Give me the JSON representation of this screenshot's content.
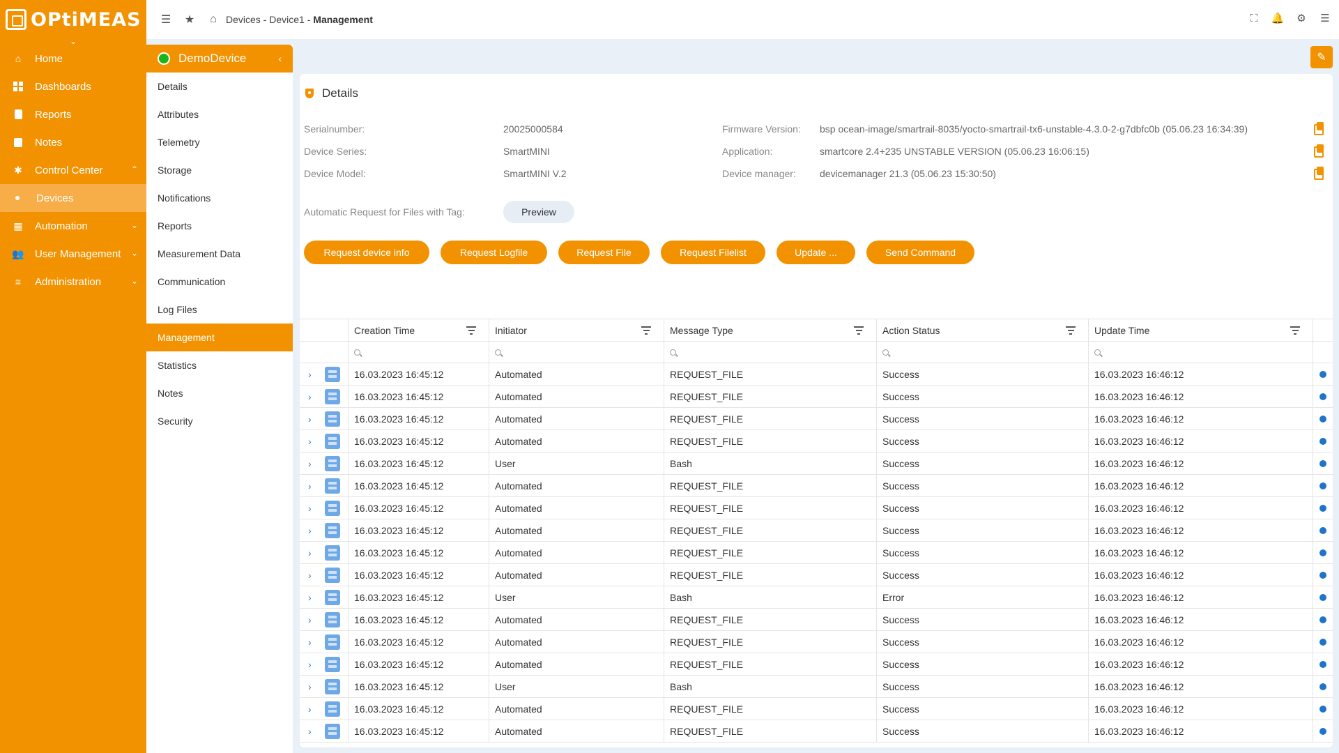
{
  "app": {
    "logo_text": "OPtiMEAS"
  },
  "sidebar": {
    "items": [
      {
        "label": "Home",
        "icon": "home-icon"
      },
      {
        "label": "Dashboards",
        "icon": "dashboard-icon"
      },
      {
        "label": "Reports",
        "icon": "report-icon"
      },
      {
        "label": "Notes",
        "icon": "notes-icon"
      },
      {
        "label": "Control Center",
        "icon": "hub-icon",
        "expanded": true
      },
      {
        "label": "Devices",
        "icon": "dot-icon",
        "active": true
      },
      {
        "label": "Automation",
        "icon": "calendar-icon"
      },
      {
        "label": "User Management",
        "icon": "users-icon"
      },
      {
        "label": "Administration",
        "icon": "list-icon"
      }
    ]
  },
  "breadcrumb": {
    "part1": "Devices",
    "sep": " - ",
    "part2": "Device1",
    "part3": "Management"
  },
  "device_panel": {
    "name": "DemoDevice",
    "status_color": "#1bb51b",
    "items": [
      "Details",
      "Attributes",
      "Telemetry",
      "Storage",
      "Notifications",
      "Reports",
      "Measurement Data",
      "Communication",
      "Log Files",
      "Management",
      "Statistics",
      "Notes",
      "Security"
    ],
    "active": "Management"
  },
  "details": {
    "title": "Details",
    "serial_label": "Serialnumber:",
    "serial_value": "20025000584",
    "series_label": "Device Series:",
    "series_value": "SmartMINI",
    "model_label": "Device Model:",
    "model_value": "SmartMINI V.2",
    "firmware_label": "Firmware Version:",
    "firmware_value": "bsp ocean-image/smartrail-8035/yocto-smartrail-tx6-unstable-4.3.0-2-g7dbfc0b (05.06.23 16:34:39)",
    "application_label": "Application:",
    "application_value": "smartcore 2.4+235 UNSTABLE VERSION (05.06.23 16:06:15)",
    "manager_label": "Device manager:",
    "manager_value": "devicemanager 21.3 (05.06.23 15:30:50)",
    "auto_request_label": "Automatic Request for Files with Tag:",
    "preview_label": "Preview"
  },
  "actions": [
    "Request device info",
    "Request Logfile",
    "Request File",
    "Request Filelist",
    "Update ...",
    "Send Command"
  ],
  "table": {
    "columns": [
      "Creation Time",
      "Initiator",
      "Message Type",
      "Action Status",
      "Update Time"
    ],
    "rows": [
      [
        "16.03.2023 16:45:12",
        "Automated",
        "REQUEST_FILE",
        "Success",
        "16.03.2023 16:46:12"
      ],
      [
        "16.03.2023 16:45:12",
        "Automated",
        "REQUEST_FILE",
        "Success",
        "16.03.2023 16:46:12"
      ],
      [
        "16.03.2023 16:45:12",
        "Automated",
        "REQUEST_FILE",
        "Success",
        "16.03.2023 16:46:12"
      ],
      [
        "16.03.2023 16:45:12",
        "Automated",
        "REQUEST_FILE",
        "Success",
        "16.03.2023 16:46:12"
      ],
      [
        "16.03.2023 16:45:12",
        "User",
        "Bash",
        "Success",
        "16.03.2023 16:46:12"
      ],
      [
        "16.03.2023 16:45:12",
        "Automated",
        "REQUEST_FILE",
        "Success",
        "16.03.2023 16:46:12"
      ],
      [
        "16.03.2023 16:45:12",
        "Automated",
        "REQUEST_FILE",
        "Success",
        "16.03.2023 16:46:12"
      ],
      [
        "16.03.2023 16:45:12",
        "Automated",
        "REQUEST_FILE",
        "Success",
        "16.03.2023 16:46:12"
      ],
      [
        "16.03.2023 16:45:12",
        "Automated",
        "REQUEST_FILE",
        "Success",
        "16.03.2023 16:46:12"
      ],
      [
        "16.03.2023 16:45:12",
        "Automated",
        "REQUEST_FILE",
        "Success",
        "16.03.2023 16:46:12"
      ],
      [
        "16.03.2023 16:45:12",
        "User",
        "Bash",
        "Error",
        "16.03.2023 16:46:12"
      ],
      [
        "16.03.2023 16:45:12",
        "Automated",
        "REQUEST_FILE",
        "Success",
        "16.03.2023 16:46:12"
      ],
      [
        "16.03.2023 16:45:12",
        "Automated",
        "REQUEST_FILE",
        "Success",
        "16.03.2023 16:46:12"
      ],
      [
        "16.03.2023 16:45:12",
        "Automated",
        "REQUEST_FILE",
        "Success",
        "16.03.2023 16:46:12"
      ],
      [
        "16.03.2023 16:45:12",
        "User",
        "Bash",
        "Success",
        "16.03.2023 16:46:12"
      ],
      [
        "16.03.2023 16:45:12",
        "Automated",
        "REQUEST_FILE",
        "Success",
        "16.03.2023 16:46:12"
      ],
      [
        "16.03.2023 16:45:12",
        "Automated",
        "REQUEST_FILE",
        "Success",
        "16.03.2023 16:46:12"
      ]
    ]
  },
  "colors": {
    "accent": "#f39200",
    "info": "#1f74c9",
    "status_online": "#1bb51b"
  }
}
